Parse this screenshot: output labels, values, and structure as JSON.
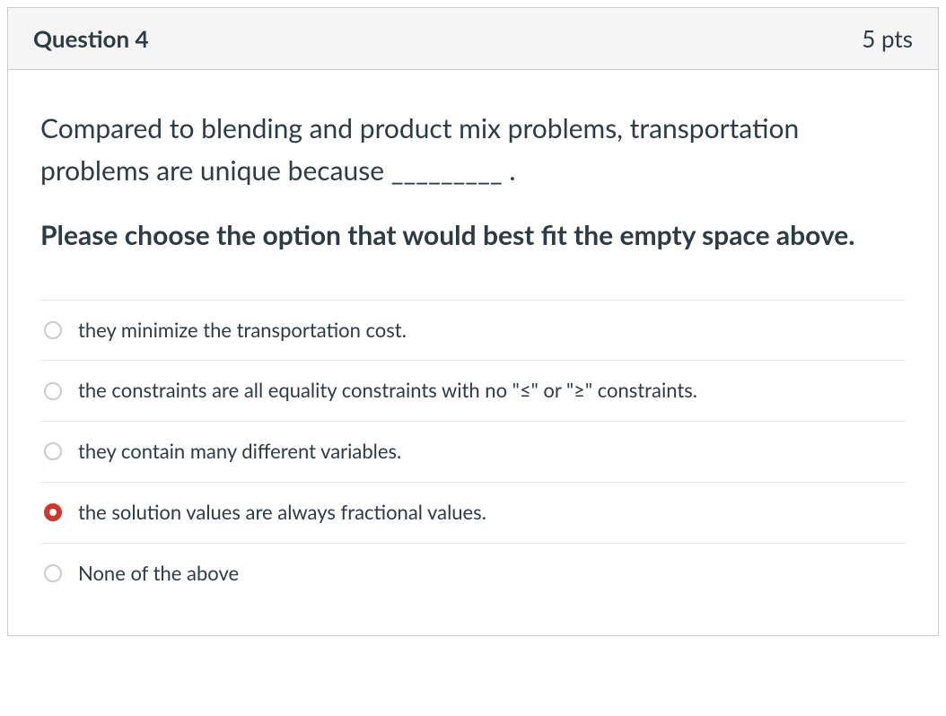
{
  "header": {
    "title": "Question 4",
    "points": "5 pts"
  },
  "body": {
    "stem": "Compared to blending and product mix problems, transportation problems are unique because _________ .",
    "instruction": "Please choose the option that would best fit the empty space above."
  },
  "answers": [
    {
      "text": "they minimize the transportation cost.",
      "selected": false
    },
    {
      "text": "the constraints are all equality constraints with no \"≤\" or \"≥\" constraints.",
      "selected": false
    },
    {
      "text": "they contain many different variables.",
      "selected": false
    },
    {
      "text": "the solution values are always fractional values.",
      "selected": true
    },
    {
      "text": "None of the above",
      "selected": false
    }
  ]
}
